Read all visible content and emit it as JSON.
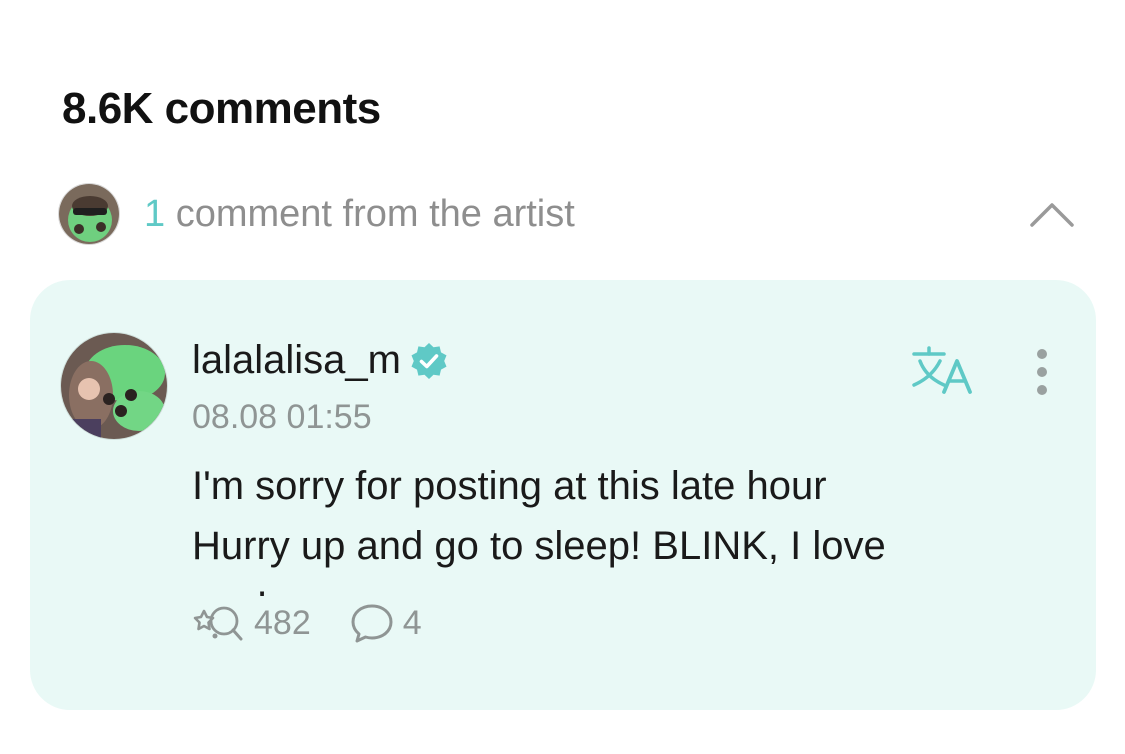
{
  "header": {
    "comments_count": "8.6K comments"
  },
  "artist_section": {
    "count": "1",
    "label": " comment from the artist",
    "toggle_icon": "chevron-up-icon"
  },
  "comment": {
    "username": "lalalalisa_m",
    "verified_icon": "verified-badge-icon",
    "timestamp": "08.08 01:55",
    "line1": "I'm sorry for posting at this late hour",
    "line2": "Hurry up and go to sleep! BLINK, I love",
    "line3": "you!",
    "likes": "482",
    "replies": "4",
    "translate_icon": "translate-icon",
    "more_icon": "more-vertical-icon"
  },
  "colors": {
    "accent": "#5fc9c6",
    "card_background": "#e9f9f6",
    "muted_text": "#8f9594"
  }
}
